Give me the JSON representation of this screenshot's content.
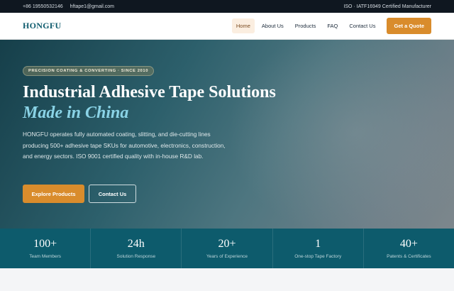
{
  "topbar": {
    "phone": "+86 19550532146",
    "email": "hftape1@gmail.com",
    "certification": "ISO · IATF16949 Certified Manufacturer"
  },
  "nav": {
    "logo": "HONGFU",
    "items": [
      {
        "label": "Home",
        "active": true
      },
      {
        "label": "About Us"
      },
      {
        "label": "Products"
      },
      {
        "label": "FAQ"
      },
      {
        "label": "Contact Us"
      }
    ],
    "cta": "Get a Quote"
  },
  "hero": {
    "badge": "PRECISION COATING & CONVERTING · SINCE 2010",
    "title_main": "Industrial Adhesive Tape Solutions ",
    "title_accent": "Made in China",
    "description": "HONGFU operates fully automated coating, slitting, and die-cutting lines producing 500+ adhesive tape SKUs for automotive, electronics, construction, and energy sectors. ISO 9001 certified quality with in-house R&D lab.",
    "primary_button": "Explore Products",
    "secondary_button": "Contact Us"
  },
  "stats": [
    {
      "value": "100+",
      "label": "Team Members"
    },
    {
      "value": "24h",
      "label": "Solution Response"
    },
    {
      "value": "20+",
      "label": "Years of Experience"
    },
    {
      "value": "1",
      "label": "One-stop Tape Factory"
    },
    {
      "value": "40+",
      "label": "Patents & Certificates"
    }
  ]
}
